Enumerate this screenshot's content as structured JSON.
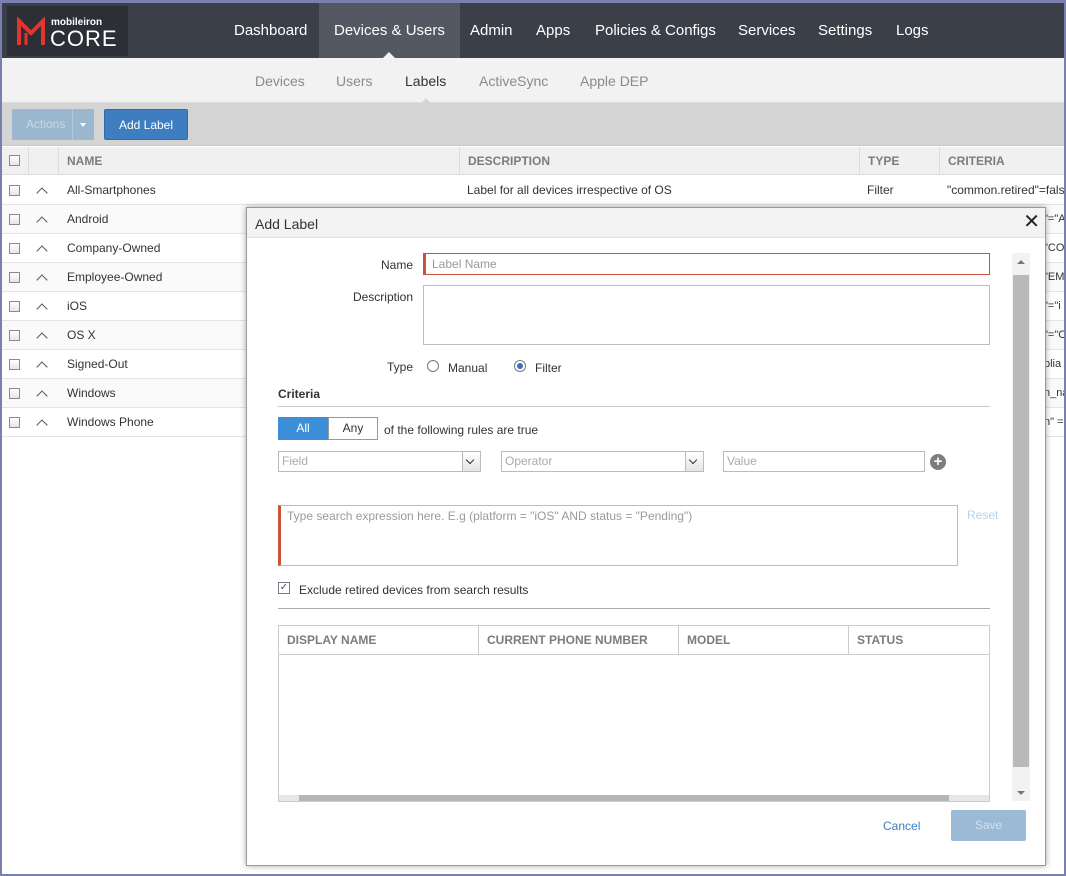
{
  "brand": {
    "small": "mobileiron",
    "big": "CORE"
  },
  "topnav": [
    "Dashboard",
    "Devices & Users",
    "Admin",
    "Apps",
    "Policies & Configs",
    "Services",
    "Settings",
    "Logs"
  ],
  "subnav": [
    "Devices",
    "Users",
    "Labels",
    "ActiveSync",
    "Apple DEP"
  ],
  "toolbar": {
    "actions": "Actions",
    "add_label": "Add Label"
  },
  "table": {
    "headers": [
      "NAME",
      "DESCRIPTION",
      "TYPE",
      "CRITERIA"
    ],
    "rows": [
      {
        "name": "All-Smartphones",
        "description": "Label for all devices irrespective of OS",
        "type": "Filter",
        "criteria": "\"common.retired\"=fals"
      },
      {
        "name": "Android",
        "criteria": "\"=\"A"
      },
      {
        "name": "Company-Owned",
        "criteria": "\"CO"
      },
      {
        "name": "Employee-Owned",
        "criteria": "\"EM"
      },
      {
        "name": "iOS",
        "criteria": "\"=\"i"
      },
      {
        "name": "OS X",
        "criteria": "\"=\"C"
      },
      {
        "name": "Signed-Out",
        "criteria": "plia"
      },
      {
        "name": "Windows",
        "criteria": "n_na"
      },
      {
        "name": "Windows Phone",
        "criteria": "n\" ="
      }
    ]
  },
  "modal": {
    "title": "Add Label",
    "close": "✕",
    "name_label": "Name",
    "name_placeholder": "Label Name",
    "description_label": "Description",
    "type_label": "Type",
    "type_manual": "Manual",
    "type_filter": "Filter",
    "criteria_title": "Criteria",
    "seg_all": "All",
    "seg_any": "Any",
    "rules_text": "of the following rules are true",
    "field_placeholder": "Field",
    "operator_placeholder": "Operator",
    "value_placeholder": "Value",
    "expression_placeholder": "Type search expression here. E.g (platform = \"iOS\" AND status = \"Pending\")",
    "reset": "Reset",
    "exclude_label": "Exclude retired devices from search results",
    "grid_headers": [
      "DISPLAY NAME",
      "CURRENT PHONE NUMBER",
      "MODEL",
      "STATUS"
    ],
    "cancel": "Cancel",
    "save": "Save"
  }
}
